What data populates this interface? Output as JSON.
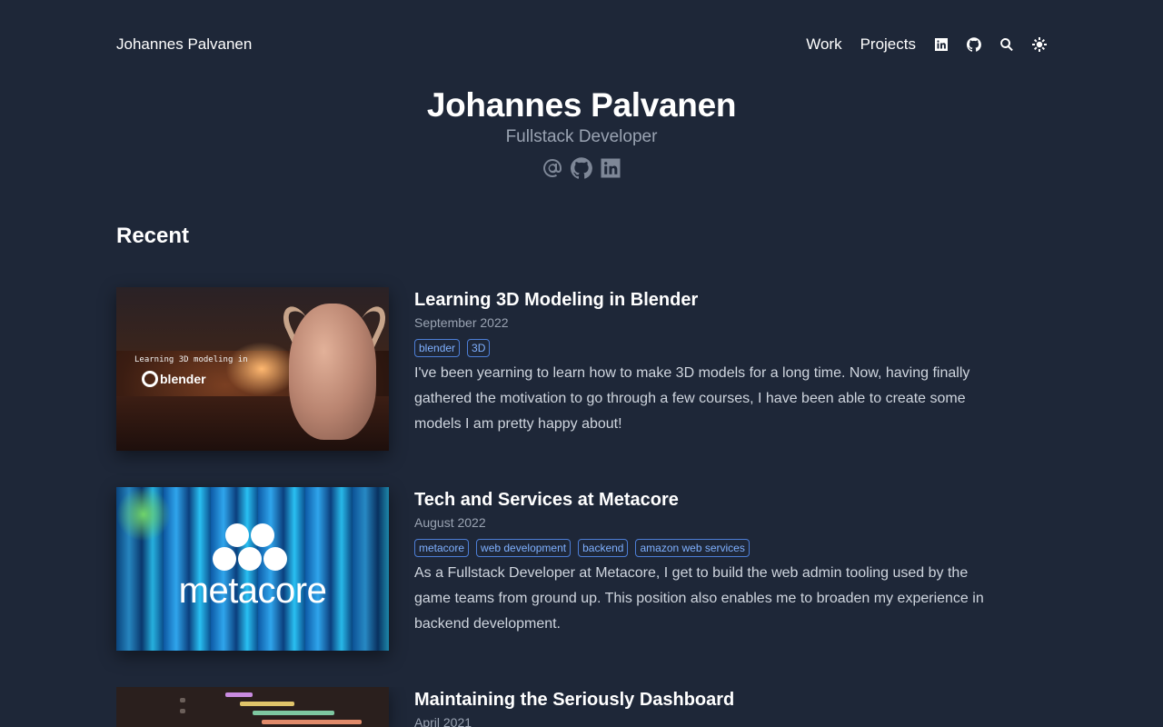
{
  "header": {
    "site_name": "Johannes Palvanen",
    "nav": [
      {
        "label": "Work"
      },
      {
        "label": "Projects"
      }
    ],
    "nav_icons": [
      "linkedin-icon",
      "github-icon",
      "search-icon",
      "theme-toggle-icon"
    ]
  },
  "hero": {
    "name": "Johannes Palvanen",
    "role": "Fullstack Developer",
    "social_icons": [
      "email-icon",
      "github-icon",
      "linkedin-icon"
    ]
  },
  "recent": {
    "title": "Recent",
    "posts": [
      {
        "title": "Learning 3D Modeling in Blender",
        "date": "September 2022",
        "tags": [
          "blender",
          "3D"
        ],
        "description": "I've been yearning to learn how to make 3D models for a long time. Now, having finally gathered the motivation to go through a few courses, I have been able to create some models I am pretty happy about!",
        "thumbnail": {
          "text_line": "Learning 3D modeling in",
          "logo_text": "blender"
        }
      },
      {
        "title": "Tech and Services at Metacore",
        "date": "August 2022",
        "tags": [
          "metacore",
          "web development",
          "backend",
          "amazon web services"
        ],
        "description": "As a Fullstack Developer at Metacore, I get to build the web admin tooling used by the game teams from ground up. This position also enables me to broaden my experience in backend development.",
        "thumbnail": {
          "logo_text": "metacore"
        }
      },
      {
        "title": "Maintaining the Seriously Dashboard",
        "date": "April 2021",
        "tags": [],
        "description": ""
      }
    ]
  },
  "colors": {
    "background": "#1e2738",
    "tag_border": "#4d7ed6",
    "tag_text": "#7fb0ff",
    "muted_text": "#9aa3b2"
  }
}
